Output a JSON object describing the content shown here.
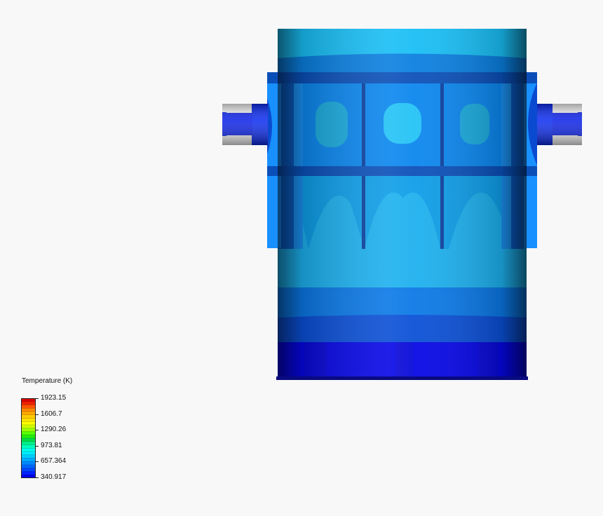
{
  "legend": {
    "title": "Temperature (K)",
    "ticks": [
      "1923.15",
      "1606.7",
      "1290.26",
      "973.81",
      "657.364",
      "340.917"
    ],
    "colors": [
      "#dd0000",
      "#ee2200",
      "#ff5500",
      "#ff8800",
      "#ffaa00",
      "#ffcc00",
      "#ffe000",
      "#ffff00",
      "#ccff00",
      "#99ff00",
      "#55ff00",
      "#22ee11",
      "#00dd44",
      "#00ee88",
      "#00ffbb",
      "#00ffee",
      "#00eeff",
      "#00ccff",
      "#00aaff",
      "#0088ff",
      "#0066ff",
      "#0044ff",
      "#0022ff",
      "#0000ee"
    ]
  },
  "scene": {
    "palette": {
      "shell_mid": "#16b8f0",
      "shell_light": "#1ed1ff",
      "shell_dark": "#003070",
      "band_blue": "#0a78e6",
      "band_mid": "#0a5ad0",
      "base_blue": "#0606e6",
      "flange_blue": "#1890ff",
      "nozzle_blue": "#0a24ee",
      "background": "#f8f8f8"
    }
  }
}
